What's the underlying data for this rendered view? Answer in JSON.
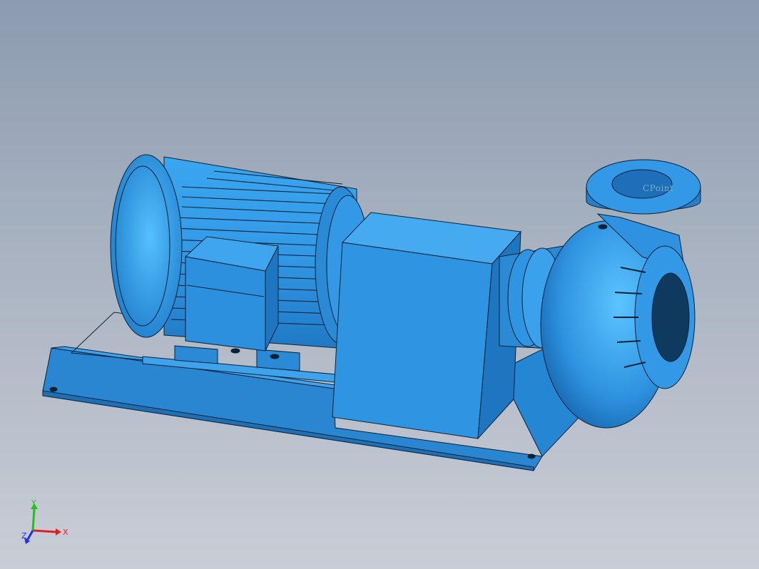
{
  "viewport": {
    "background_top": "#8c9bb0",
    "background_bottom": "#c9cdd6"
  },
  "model": {
    "body_color": "#3399e6",
    "shade_color": "#1c6fb8",
    "edge_color": "#0b2236",
    "point_label": "CPoint"
  },
  "triad": {
    "x_label": "X",
    "y_label": "Y",
    "z_label": "Z",
    "x_color": "#e02020",
    "y_color": "#20c020",
    "z_color": "#2030e0"
  }
}
